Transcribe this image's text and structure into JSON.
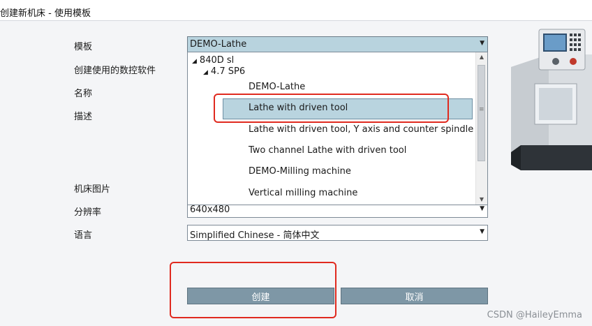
{
  "window": {
    "title": "创建新机床 - 使用模板"
  },
  "fields": {
    "template_label": "模板",
    "software_label": "创建使用的数控软件",
    "name_label": "名称",
    "description_label": "描述",
    "image_label": "机床图片",
    "resolution_label": "分辨率",
    "language_label": "语言"
  },
  "template_combo": {
    "value": "DEMO-Lathe"
  },
  "resolution_combo": {
    "value": "640x480"
  },
  "language_combo": {
    "value": "Simplified Chinese - 简体中文"
  },
  "dropdown": {
    "tree": [
      {
        "label": "840D sl"
      },
      {
        "label": "4.7 SP6"
      }
    ],
    "options": [
      {
        "label": "DEMO-Lathe"
      },
      {
        "label": "Lathe with driven tool",
        "selected": true
      },
      {
        "label": "Lathe with driven tool, Y axis and counter spindle"
      },
      {
        "label": "Two channel Lathe with driven tool"
      },
      {
        "label": "DEMO-Milling machine"
      },
      {
        "label": "Vertical milling machine"
      }
    ]
  },
  "buttons": {
    "create_label": "创建",
    "cancel_label": "取消"
  },
  "watermark": "CSDN @HaileyEmma",
  "colors": {
    "accent": "#b9d4df",
    "button": "#7e97a6",
    "annotation": "#e02a1f"
  }
}
